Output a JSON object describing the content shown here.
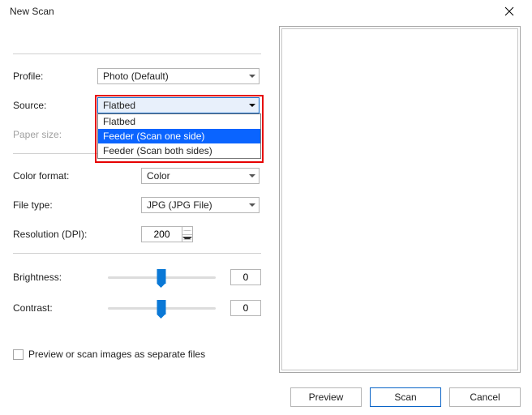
{
  "window": {
    "title": "New Scan"
  },
  "profile": {
    "label": "Profile:",
    "value": "Photo (Default)"
  },
  "source": {
    "label": "Source:",
    "value": "Flatbed",
    "options": [
      "Flatbed",
      "Feeder (Scan one side)",
      "Feeder (Scan both sides)"
    ],
    "selected_index": 1
  },
  "paper": {
    "label": "Paper size:"
  },
  "colorfmt": {
    "label": "Color format:",
    "value": "Color"
  },
  "filetype": {
    "label": "File type:",
    "value": "JPG (JPG File)"
  },
  "resolution": {
    "label": "Resolution (DPI):",
    "value": "200"
  },
  "brightness": {
    "label": "Brightness:",
    "value": "0"
  },
  "contrast": {
    "label": "Contrast:",
    "value": "0"
  },
  "separate": {
    "label": "Preview or scan images as separate files"
  },
  "buttons": {
    "preview": "Preview",
    "scan": "Scan",
    "cancel": "Cancel"
  }
}
